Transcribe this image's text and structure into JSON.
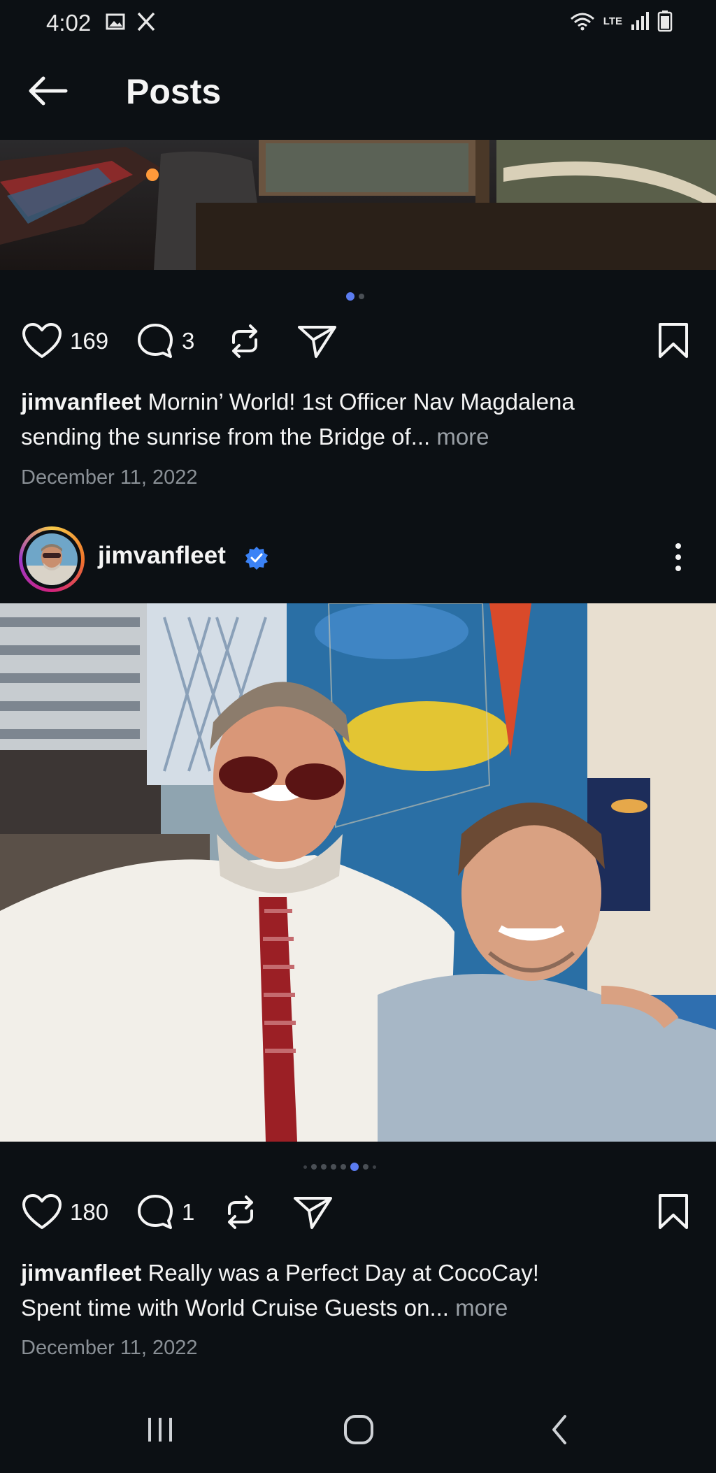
{
  "status_bar": {
    "time": "4:02",
    "left_icons": [
      "gallery-icon",
      "x-logo-icon"
    ],
    "right_icons": [
      "wifi-icon",
      "lte-icon",
      "signal-icon",
      "battery-icon"
    ],
    "network": "LTE"
  },
  "header": {
    "title": "Posts",
    "back_icon": "arrow-left-icon"
  },
  "posts": [
    {
      "likes": "169",
      "comments": "3",
      "carousel_total": 2,
      "carousel_active": 1,
      "username": "jimvanfleet",
      "caption_line1": " Mornin’ World! 1st Officer Nav Magdalena",
      "caption_line2": "sending the sunrise from the Bridge of...",
      "more": "more",
      "date": "December 11, 2022"
    },
    {
      "username": "jimvanfleet",
      "verified": true,
      "likes": "180",
      "comments": "1",
      "carousel_total": 8,
      "carousel_active": 6,
      "caption_line1": " Really was a Perfect Day at CocoCay!",
      "caption_line2": "Spent time with World Cruise Guests on...",
      "more": "more",
      "date": "December 11, 2022"
    }
  ],
  "nav_bar": {
    "icons": [
      "recent-apps-icon",
      "home-icon",
      "back-icon"
    ]
  },
  "colors": {
    "background": "#0c1014",
    "accent": "#5b7cf0",
    "verified": "#3b82f6",
    "secondary_text": "#8a9096"
  }
}
